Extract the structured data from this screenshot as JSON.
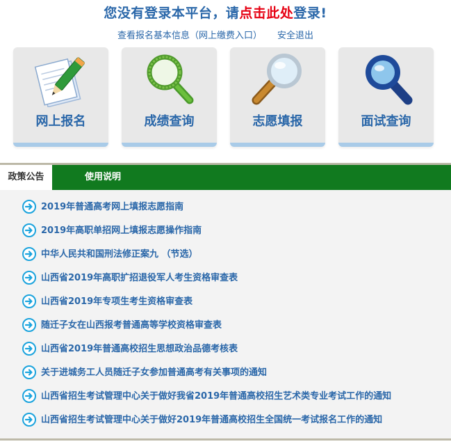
{
  "header": {
    "title_prefix": "您没有登录本平台，请",
    "title_link": "点击此处",
    "title_suffix": "登录!",
    "view_info_link": "查看报名基本信息（网上缴费入口）",
    "logout_link": "安全退出"
  },
  "tiles": [
    {
      "label": "网上报名",
      "icon": "pencil-paper-icon"
    },
    {
      "label": "成绩查询",
      "icon": "green-magnifier-icon"
    },
    {
      "label": "志愿填报",
      "icon": "wooden-magnifier-icon"
    },
    {
      "label": "面试查询",
      "icon": "blue-magnifier-icon"
    }
  ],
  "tabs": {
    "policy": "政策公告",
    "instructions": "使用说明"
  },
  "notices": [
    "2019年普通高考网上填报志愿指南",
    "2019年高职单招网上填报志愿操作指南",
    "中华人民共和国刑法修正案九 （节选）",
    "山西省2019年高职扩招退役军人考生资格审查表",
    "山西省2019年专项生考生资格审查表",
    "随迁子女在山西报考普通高等学校资格审查表",
    "山西省2019年普通高校招生思想政治品德考核表",
    "关于进城务工人员随迁子女参加普通高考有关事项的通知",
    "山西省招生考试管理中心关于做好我省2019年普通高校招生艺术类专业考试工作的通知",
    "山西省招生考试管理中心关于做好2019年普通高校招生全国统一考试报名工作的通知"
  ],
  "colors": {
    "link_blue": "#2a67a9",
    "login_red": "#e60012",
    "tab_green": "#117a1f",
    "arrow_blue": "#1aa3dd"
  }
}
